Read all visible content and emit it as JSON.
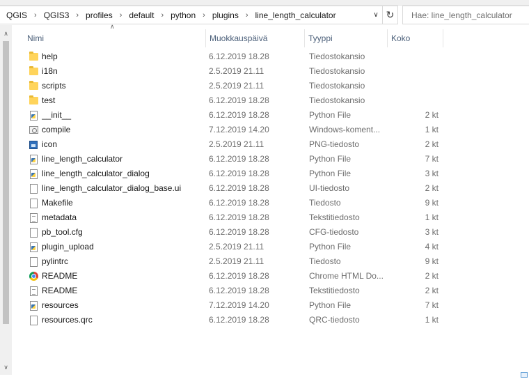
{
  "address": {
    "crumbs": [
      "QGIS",
      "QGIS3",
      "profiles",
      "default",
      "python",
      "plugins",
      "line_length_calculator"
    ]
  },
  "search": {
    "placeholder": "Hae: line_length_calculator"
  },
  "columns": {
    "name": "Nimi",
    "date": "Muokkauspäivä",
    "type": "Tyyppi",
    "size": "Koko"
  },
  "files": [
    {
      "name": "help",
      "date": "6.12.2019 18.28",
      "type": "Tiedostokansio",
      "size": "",
      "icon": "folder-icon"
    },
    {
      "name": "i18n",
      "date": "2.5.2019 21.11",
      "type": "Tiedostokansio",
      "size": "",
      "icon": "folder-icon"
    },
    {
      "name": "scripts",
      "date": "2.5.2019 21.11",
      "type": "Tiedostokansio",
      "size": "",
      "icon": "folder-icon"
    },
    {
      "name": "test",
      "date": "6.12.2019 18.28",
      "type": "Tiedostokansio",
      "size": "",
      "icon": "folder-icon"
    },
    {
      "name": "__init__",
      "date": "6.12.2019 18.28",
      "type": "Python File",
      "size": "2 kt",
      "icon": "python-file-icon"
    },
    {
      "name": "compile",
      "date": "7.12.2019 14.20",
      "type": "Windows-koment...",
      "size": "1 kt",
      "icon": "command-script-icon"
    },
    {
      "name": "icon",
      "date": "2.5.2019 21.11",
      "type": "PNG-tiedosto",
      "size": "2 kt",
      "icon": "image-file-icon"
    },
    {
      "name": "line_length_calculator",
      "date": "6.12.2019 18.28",
      "type": "Python File",
      "size": "7 kt",
      "icon": "python-file-icon"
    },
    {
      "name": "line_length_calculator_dialog",
      "date": "6.12.2019 18.28",
      "type": "Python File",
      "size": "3 kt",
      "icon": "python-file-icon"
    },
    {
      "name": "line_length_calculator_dialog_base.ui",
      "date": "6.12.2019 18.28",
      "type": "UI-tiedosto",
      "size": "2 kt",
      "icon": "blank-file-icon"
    },
    {
      "name": "Makefile",
      "date": "6.12.2019 18.28",
      "type": "Tiedosto",
      "size": "9 kt",
      "icon": "blank-file-icon"
    },
    {
      "name": "metadata",
      "date": "6.12.2019 18.28",
      "type": "Tekstitiedosto",
      "size": "1 kt",
      "icon": "text-file-icon"
    },
    {
      "name": "pb_tool.cfg",
      "date": "6.12.2019 18.28",
      "type": "CFG-tiedosto",
      "size": "3 kt",
      "icon": "blank-file-icon"
    },
    {
      "name": "plugin_upload",
      "date": "2.5.2019 21.11",
      "type": "Python File",
      "size": "4 kt",
      "icon": "python-file-icon"
    },
    {
      "name": "pylintrc",
      "date": "2.5.2019 21.11",
      "type": "Tiedosto",
      "size": "9 kt",
      "icon": "blank-file-icon"
    },
    {
      "name": "README",
      "date": "6.12.2019 18.28",
      "type": "Chrome HTML Do...",
      "size": "2 kt",
      "icon": "chrome-html-icon"
    },
    {
      "name": "README",
      "date": "6.12.2019 18.28",
      "type": "Tekstitiedosto",
      "size": "2 kt",
      "icon": "text-file-icon"
    },
    {
      "name": "resources",
      "date": "7.12.2019 14.20",
      "type": "Python File",
      "size": "7 kt",
      "icon": "python-file-icon"
    },
    {
      "name": "resources.qrc",
      "date": "6.12.2019 18.28",
      "type": "QRC-tiedosto",
      "size": "1 kt",
      "icon": "blank-file-icon"
    }
  ]
}
